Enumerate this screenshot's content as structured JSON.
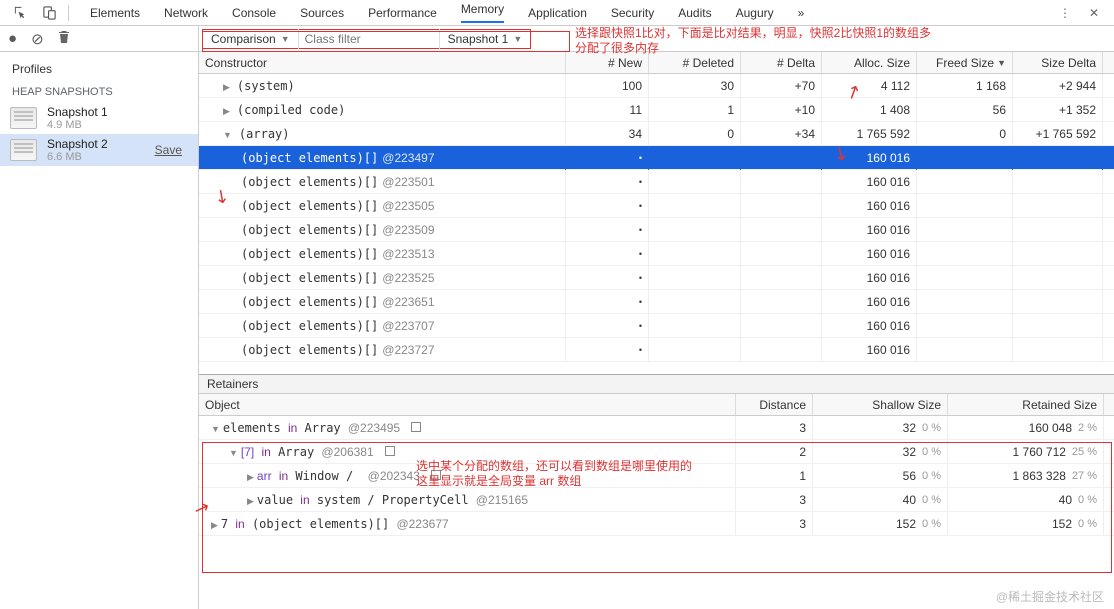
{
  "toolbar": {
    "tabs": [
      "Elements",
      "Network",
      "Console",
      "Sources",
      "Performance",
      "Memory",
      "Application",
      "Security",
      "Audits",
      "Augury"
    ],
    "active": 5
  },
  "sidebar": {
    "header": "Profiles",
    "section": "HEAP SNAPSHOTS",
    "snapshots": [
      {
        "name": "Snapshot 1",
        "size": "4.9 MB"
      },
      {
        "name": "Snapshot 2",
        "size": "6.6 MB"
      }
    ],
    "save": "Save"
  },
  "filters": {
    "view": "Comparison",
    "class_filter_placeholder": "Class filter",
    "compare_to": "Snapshot 1"
  },
  "annotations": {
    "top1": "选择跟快照1比对，下面是比对结果，明显，快照2比快照1的数组多",
    "top2": "分配了很多内存",
    "ret1": "选中某个分配的数组，还可以看到数组是哪里使用的",
    "ret2": "这里显示就是全局变量 arr 数组"
  },
  "grid": {
    "headers": {
      "con": "Constructor",
      "new": "# New",
      "del": "# Deleted",
      "dlt": "# Delta",
      "alc": "Alloc. Size",
      "frs": "Freed Size",
      "sdl": "Size Delta"
    },
    "rows": [
      {
        "lvl": 1,
        "tri": "r",
        "name": "(system)",
        "new": "100",
        "del": "30",
        "dlt": "+70",
        "alc": "4 112",
        "frs": "1 168",
        "sdl": "+2 944"
      },
      {
        "lvl": 1,
        "tri": "r",
        "name": "(compiled code)",
        "new": "11",
        "del": "1",
        "dlt": "+10",
        "alc": "1 408",
        "frs": "56",
        "sdl": "+1 352"
      },
      {
        "lvl": 1,
        "tri": "d",
        "name": "(array)",
        "new": "34",
        "del": "0",
        "dlt": "+34",
        "alc": "1 765 592",
        "frs": "0",
        "sdl": "+1 765 592"
      },
      {
        "lvl": 2,
        "obj": "(object elements)[]",
        "id": "@223497",
        "new": "•",
        "del": "",
        "dlt": "",
        "alc": "160 016",
        "frs": "",
        "sdl": "",
        "selected": true
      },
      {
        "lvl": 2,
        "obj": "(object elements)[]",
        "id": "@223501",
        "new": "•",
        "del": "",
        "dlt": "",
        "alc": "160 016",
        "frs": "",
        "sdl": ""
      },
      {
        "lvl": 2,
        "obj": "(object elements)[]",
        "id": "@223505",
        "new": "•",
        "del": "",
        "dlt": "",
        "alc": "160 016",
        "frs": "",
        "sdl": ""
      },
      {
        "lvl": 2,
        "obj": "(object elements)[]",
        "id": "@223509",
        "new": "•",
        "del": "",
        "dlt": "",
        "alc": "160 016",
        "frs": "",
        "sdl": ""
      },
      {
        "lvl": 2,
        "obj": "(object elements)[]",
        "id": "@223513",
        "new": "•",
        "del": "",
        "dlt": "",
        "alc": "160 016",
        "frs": "",
        "sdl": ""
      },
      {
        "lvl": 2,
        "obj": "(object elements)[]",
        "id": "@223525",
        "new": "•",
        "del": "",
        "dlt": "",
        "alc": "160 016",
        "frs": "",
        "sdl": ""
      },
      {
        "lvl": 2,
        "obj": "(object elements)[]",
        "id": "@223651",
        "new": "•",
        "del": "",
        "dlt": "",
        "alc": "160 016",
        "frs": "",
        "sdl": ""
      },
      {
        "lvl": 2,
        "obj": "(object elements)[]",
        "id": "@223707",
        "new": "•",
        "del": "",
        "dlt": "",
        "alc": "160 016",
        "frs": "",
        "sdl": ""
      },
      {
        "lvl": 2,
        "obj": "(object elements)[]",
        "id": "@223727",
        "new": "•",
        "del": "",
        "dlt": "",
        "alc": "160 016",
        "frs": "",
        "sdl": ""
      }
    ]
  },
  "retainers": {
    "title": "Retainers",
    "headers": {
      "obj": "Object",
      "dist": "Distance",
      "shal": "Shallow Size",
      "ret": "Retained Size"
    },
    "rows": [
      {
        "lvl": 1,
        "tri": "d",
        "html": "elements <span class='kwd'>in</span> Array <span class='obj-id'>@223495</span> <span class='chk'></span>",
        "dist": "3",
        "shal": "32",
        "shalp": "0 %",
        "ret": "160 048",
        "retp": "2 %"
      },
      {
        "lvl": 2,
        "tri": "d",
        "html": "<span class='obj-dark'>[7]</span> <span class='kwd'>in</span> Array <span class='obj-id'>@206381</span> <span class='chk'></span>",
        "dist": "2",
        "shal": "32",
        "shalp": "0 %",
        "ret": "1 760 712",
        "retp": "25 %"
      },
      {
        "lvl": 3,
        "tri": "r",
        "html": "<span class='obj-dark'>arr</span> <span class='kwd'>in</span> Window / &nbsp;<span class='obj-id'>@202343</span> <span class='chk'></span>",
        "dist": "1",
        "shal": "56",
        "shalp": "0 %",
        "ret": "1 863 328",
        "retp": "27 %"
      },
      {
        "lvl": 3,
        "tri": "r",
        "html": "value <span class='kwd'>in</span> system / PropertyCell <span class='obj-id'>@215165</span>",
        "dist": "3",
        "shal": "40",
        "shalp": "0 %",
        "ret": "40",
        "retp": "0 %"
      },
      {
        "lvl": 1,
        "tri": "r",
        "html": "7 <span class='kwd'>in</span> (object elements)[] <span class='obj-id'>@223677</span>",
        "dist": "3",
        "shal": "152",
        "shalp": "0 %",
        "ret": "152",
        "retp": "0 %"
      }
    ]
  },
  "watermark": "@稀土掘金技术社区",
  "more_icon": "»"
}
